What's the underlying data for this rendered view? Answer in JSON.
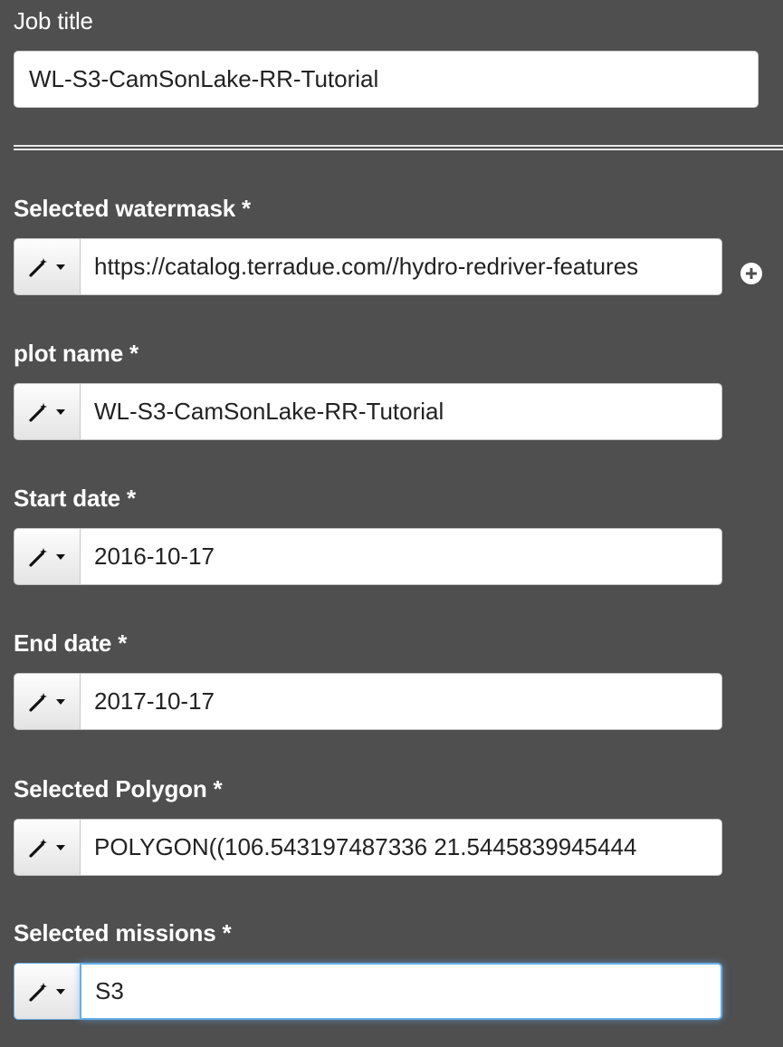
{
  "job": {
    "label": "Job title",
    "value": "WL-S3-CamSonLake-RR-Tutorial"
  },
  "fields": [
    {
      "label": "Selected watermask *",
      "value": "https://catalog.terradue.com//hydro-redriver-features",
      "icon": "magic-wand-icon"
    },
    {
      "label": "plot name *",
      "value": "WL-S3-CamSonLake-RR-Tutorial",
      "icon": "magic-wand-icon"
    },
    {
      "label": "Start date *",
      "value": "2016-10-17",
      "icon": "magic-wand-icon"
    },
    {
      "label": "End date *",
      "value": "2017-10-17",
      "icon": "magic-wand-icon"
    },
    {
      "label": "Selected Polygon *",
      "value": "POLYGON((106.543197487336 21.5445839945444",
      "icon": "magic-wand-icon"
    },
    {
      "label": "Selected missions *",
      "value": "S3",
      "icon": "magic-wand-icon"
    }
  ],
  "icons": {
    "add": "plus-circle-icon",
    "dropdown": "caret-down-icon"
  },
  "colors": {
    "background": "#4f4f4f",
    "label": "#ffffff",
    "focus": "#66afe9"
  }
}
